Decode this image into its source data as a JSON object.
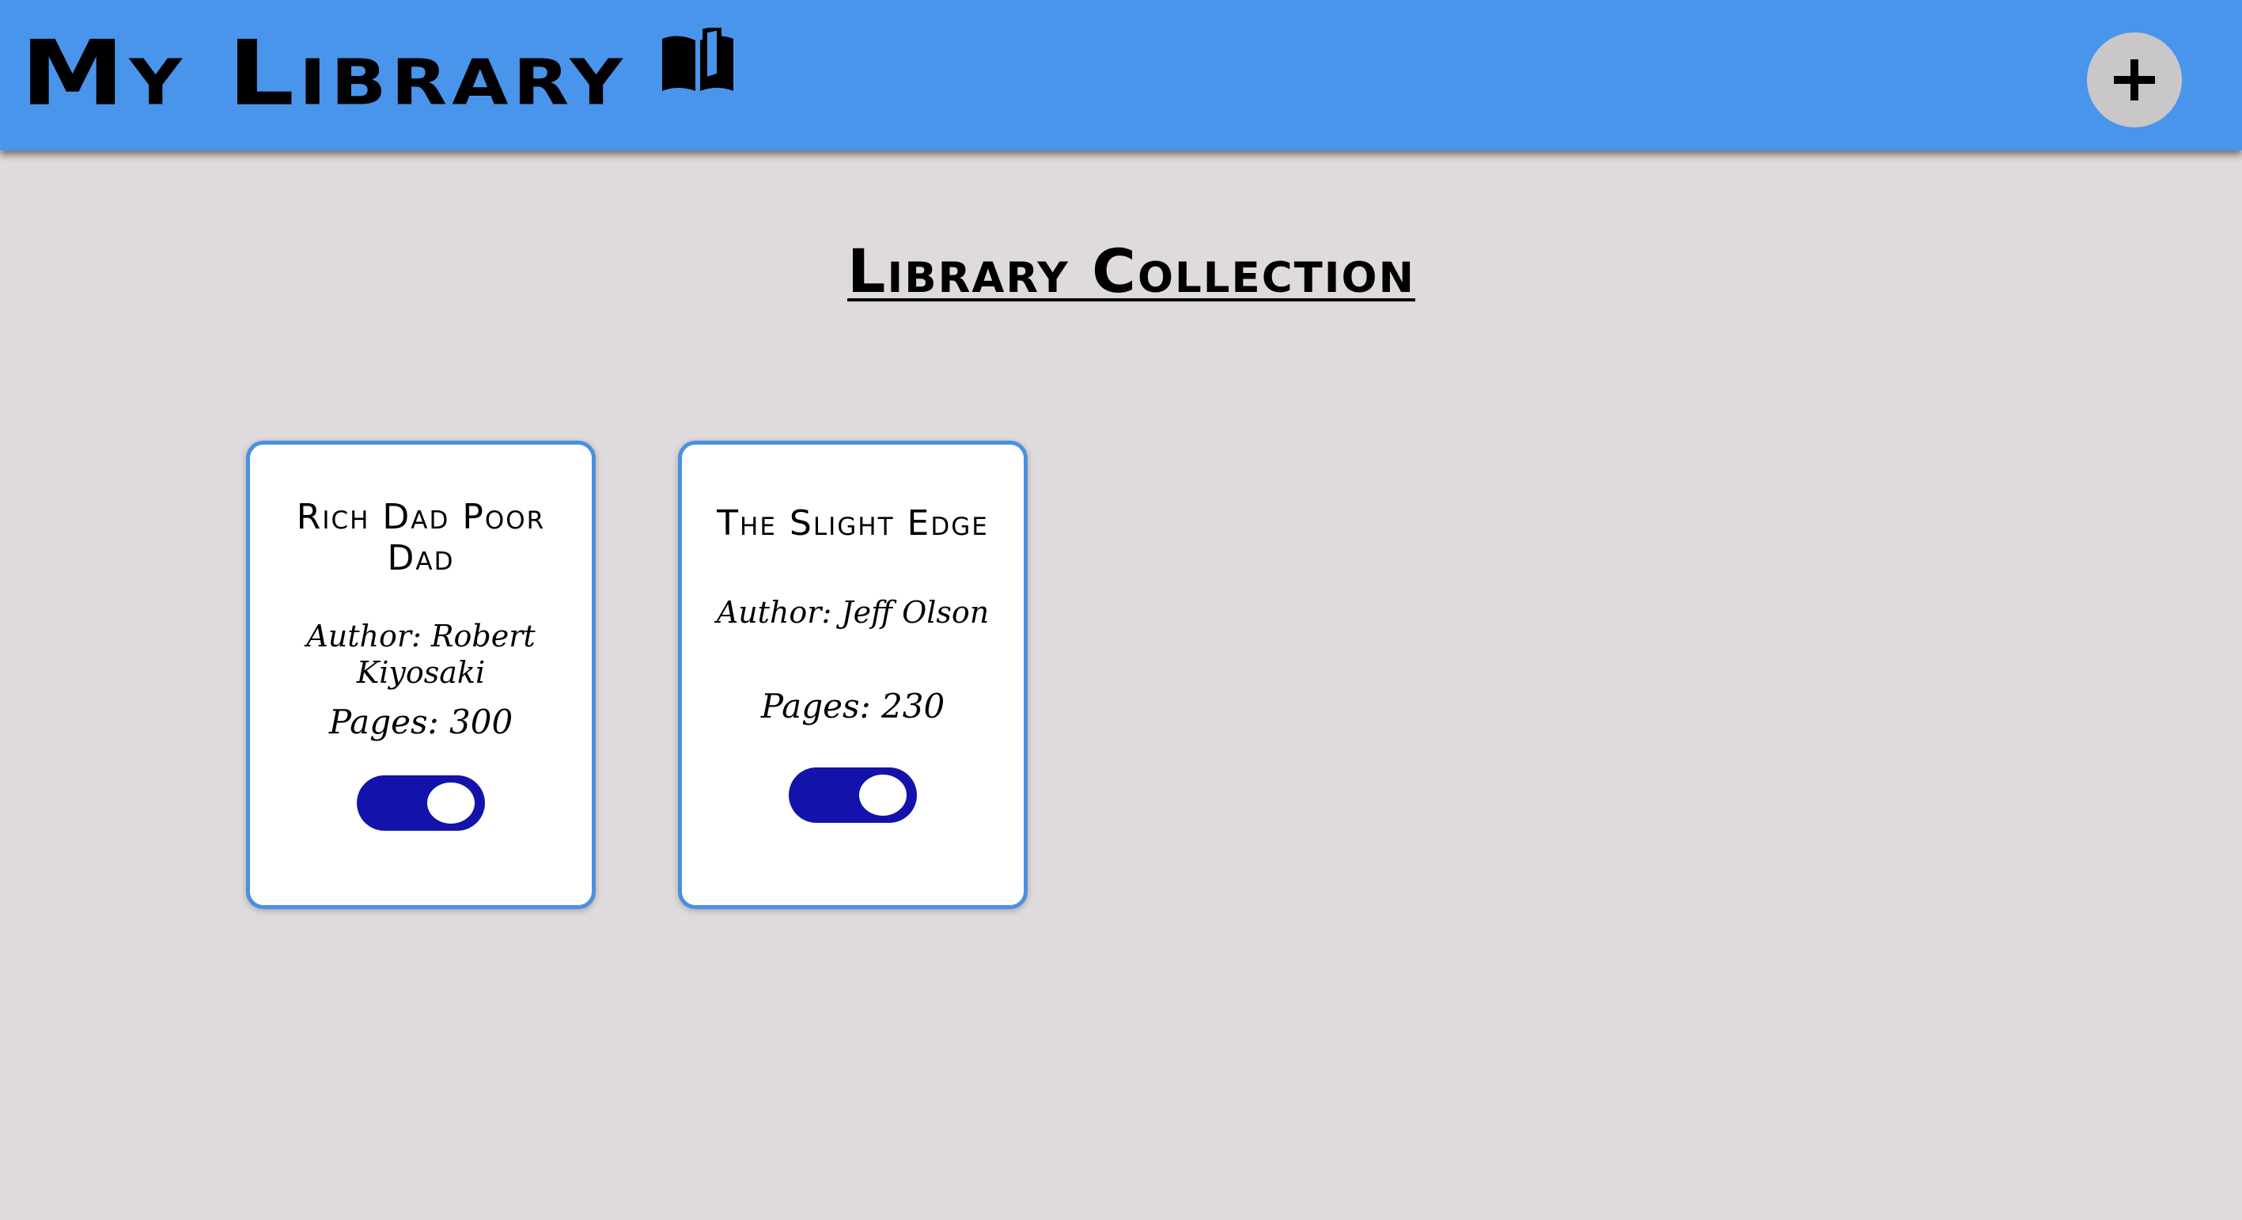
{
  "header": {
    "title": "My Library",
    "book_icon": "open-book-icon",
    "add_button_icon": "plus-icon"
  },
  "main": {
    "section_title": "Library Collection"
  },
  "books": [
    {
      "title": "Rich Dad Poor Dad",
      "author": "Author: Robert Kiyosaki",
      "pages": "Pages: 300",
      "read_toggle_on": true
    },
    {
      "title": "The Slight Edge",
      "author": "Author: Jeff Olson",
      "pages": "Pages: 230",
      "read_toggle_on": true
    }
  ],
  "colors": {
    "header_bg": "#4a95ec",
    "page_bg": "#dfdadb",
    "card_border": "#4a90e2",
    "toggle_on": "#1313ab",
    "add_button_bg": "#c9c7c8"
  }
}
